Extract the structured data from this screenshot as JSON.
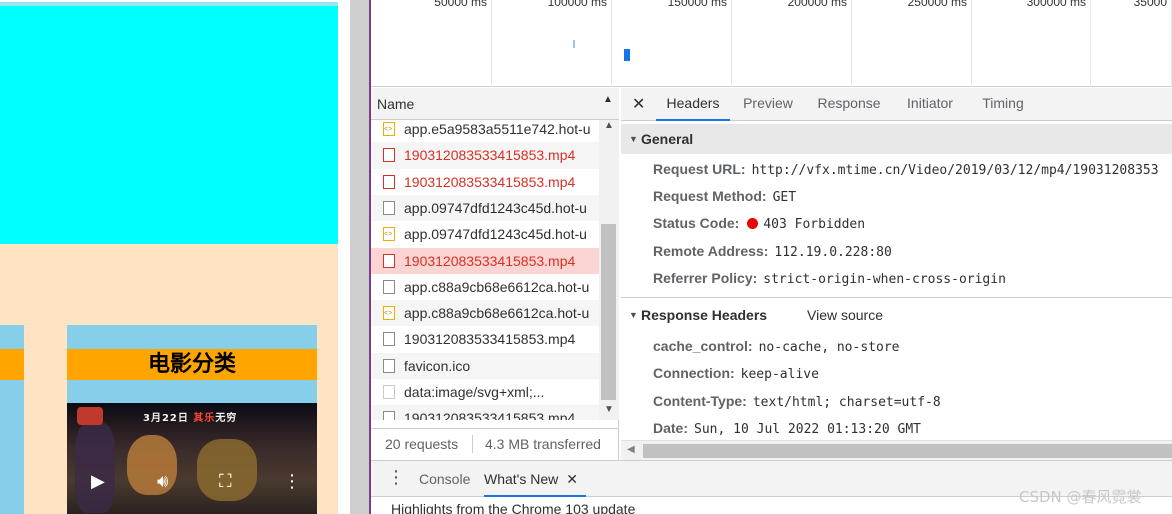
{
  "page": {
    "card_title": "电影分类",
    "video": {
      "caption_prefix": "3月22日",
      "caption_highlight": "其乐",
      "caption_suffix": "无穷",
      "play_icon": "play-icon",
      "volume_icon": "volume-icon",
      "fullscreen_icon": "fullscreen-icon",
      "more_icon": "more-vert-icon"
    }
  },
  "overview": {
    "ticks": [
      "50000 ms",
      "100000 ms",
      "150000 ms",
      "200000 ms",
      "250000 ms",
      "300000 ms",
      "35000"
    ]
  },
  "requests": {
    "column_name": "Name",
    "rows": [
      {
        "name": "app.e5a9583a5511e742.hot-u",
        "type": "js",
        "status": "ok"
      },
      {
        "name": "190312083533415853.mp4",
        "type": "media",
        "status": "error"
      },
      {
        "name": "190312083533415853.mp4",
        "type": "media",
        "status": "error"
      },
      {
        "name": "app.09747dfd1243c45d.hot-u",
        "type": "doc",
        "status": "ok"
      },
      {
        "name": "app.09747dfd1243c45d.hot-u",
        "type": "js",
        "status": "ok"
      },
      {
        "name": "190312083533415853.mp4",
        "type": "media",
        "status": "error-selected"
      },
      {
        "name": "app.c88a9cb68e6612ca.hot-u",
        "type": "doc",
        "status": "ok"
      },
      {
        "name": "app.c88a9cb68e6612ca.hot-u",
        "type": "js",
        "status": "ok"
      },
      {
        "name": "190312083533415853.mp4",
        "type": "doc",
        "status": "ok"
      },
      {
        "name": "favicon.ico",
        "type": "doc",
        "status": "ok"
      },
      {
        "name": "data:image/svg+xml;...",
        "type": "img",
        "status": "ok"
      },
      {
        "name": "190312083533415853.mp4",
        "type": "doc",
        "status": "ok"
      }
    ],
    "footer_count": "20 requests",
    "footer_transferred": "4.3 MB transferred"
  },
  "details": {
    "tabs": [
      "Headers",
      "Preview",
      "Response",
      "Initiator",
      "Timing"
    ],
    "active_tab": "Headers",
    "general": {
      "title": "General",
      "request_url_label": "Request URL:",
      "request_url": "http://vfx.mtime.cn/Video/2019/03/12/mp4/19031208353",
      "request_method_label": "Request Method:",
      "request_method": "GET",
      "status_code_label": "Status Code:",
      "status_code": "403 Forbidden",
      "status_color": "#ee0000",
      "remote_address_label": "Remote Address:",
      "remote_address": "112.19.0.228:80",
      "referrer_policy_label": "Referrer Policy:",
      "referrer_policy": "strict-origin-when-cross-origin"
    },
    "response_headers": {
      "title": "Response Headers",
      "view_source": "View source",
      "items": [
        {
          "k": "cache_control:",
          "v": "no-cache, no-store"
        },
        {
          "k": "Connection:",
          "v": "keep-alive"
        },
        {
          "k": "Content-Type:",
          "v": "text/html; charset=utf-8"
        },
        {
          "k": "Date:",
          "v": "Sun, 10 Jul 2022 01:13:20 GMT"
        }
      ]
    }
  },
  "drawer": {
    "tabs": [
      "Console",
      "What's New"
    ],
    "active_tab": "What's New",
    "body": "Highlights from the Chrome 103 update"
  },
  "watermark": "CSDN @春风霓裳",
  "colors": {
    "accent": "#1a73e8",
    "error_text": "#d93025",
    "selected_row": "#fbd5d3",
    "page_cyan": "#00ffff",
    "page_bisque": "#ffe4c4",
    "page_skyblue": "#87ceeb",
    "page_orange": "#ffa500"
  }
}
